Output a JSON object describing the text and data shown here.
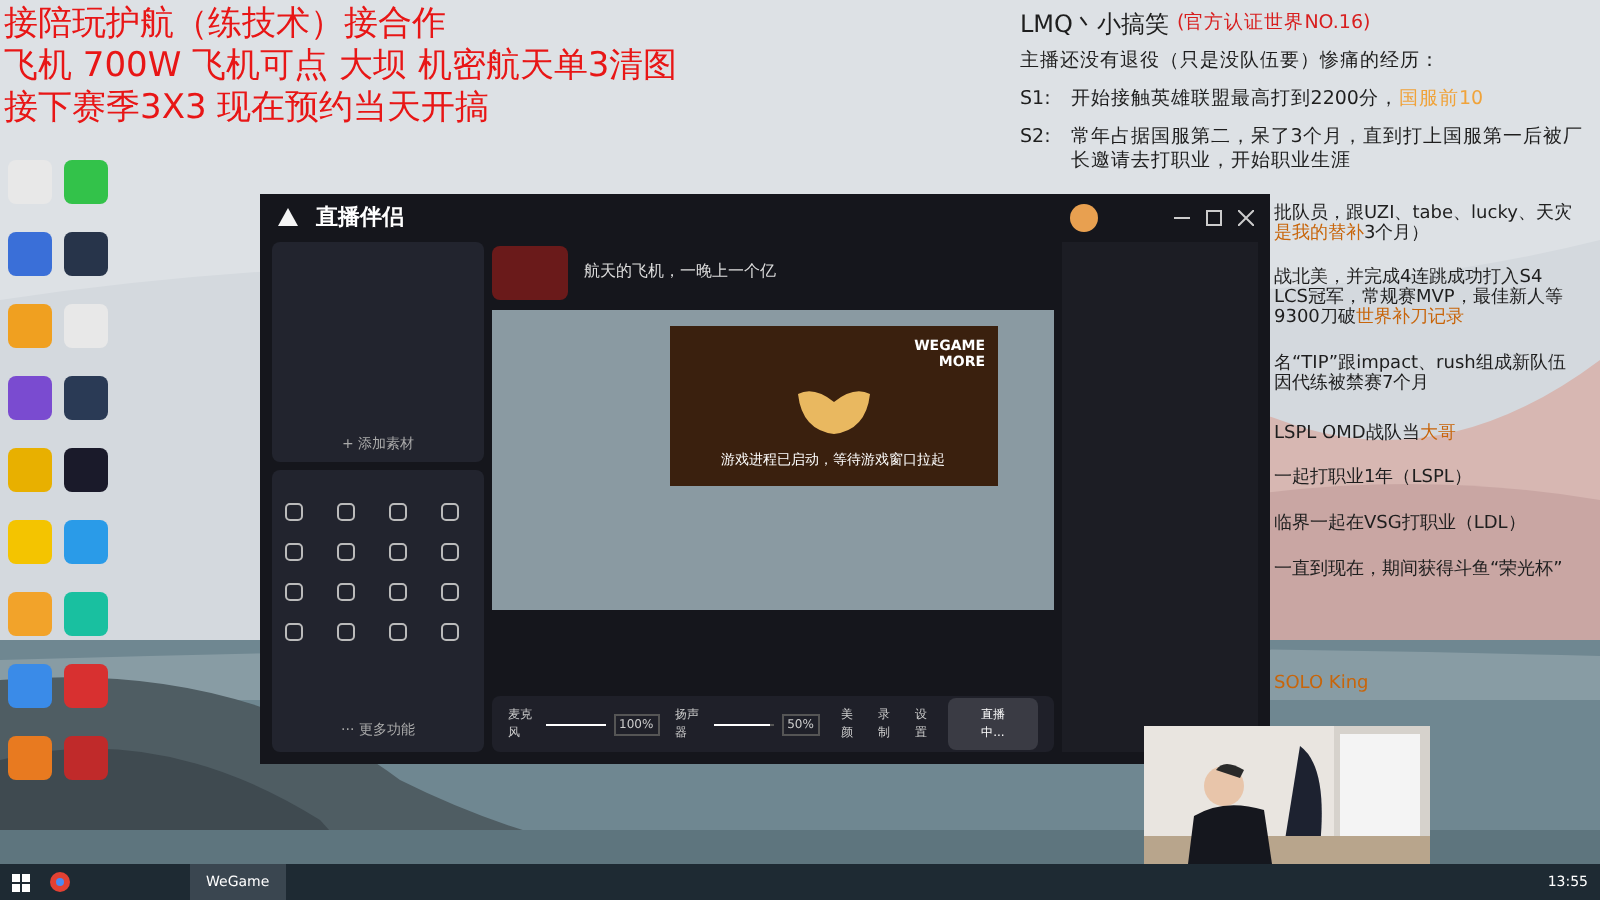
{
  "overlay_text": [
    "接陪玩护航（练技术）接合作",
    "飞机 700W  飞机可点 大坝 机密航天单3清图",
    "接下赛季3X3  现在预约当天开搞"
  ],
  "bio": {
    "name": "LMQ丶小搞笑",
    "badge": "(官方认证世界NO.16)",
    "intro": "主播还没有退役（只是没队伍要）惨痛的经历：",
    "entries": [
      {
        "label": "S1:",
        "text": "开始接触英雄联盟最高打到2200分，",
        "highlight": "国服前10"
      },
      {
        "label": "S2:",
        "text": "常年占据国服第二，呆了3个月，直到打上国服第一后被厂长邀请去打职业，开始职业生涯"
      }
    ],
    "fragments": [
      {
        "text": "批队员，跟UZI、tabe、lucky、天灾"
      },
      {
        "highlight": "是我的替补",
        "rest": "3个月）"
      },
      {
        "text": "战北美，并完成4连跳成功打入S4"
      },
      {
        "text": "LCS冠军，常规赛MVP，最佳新人等"
      },
      {
        "text": "9300刀破",
        "highlight": "世界补刀记录"
      },
      {
        "text": "名“TIP”跟impact、rush组成新队伍"
      },
      {
        "text": "因代练被禁赛7个月"
      },
      {
        "text": "LSPL OMD战队当",
        "highlight": "大哥"
      },
      {
        "text": "一起打职业1年（LSPL）"
      },
      {
        "text": "临界一起在VSG打职业（LDL）"
      },
      {
        "text": "一直到现在，期间获得斗鱼“荣光杯”"
      },
      {
        "highlight": "SOLO King"
      }
    ]
  },
  "app": {
    "title": "直播伴侣",
    "stream_title": "航天的飞机，一晚上一个亿",
    "add_source": "+ 添加素材",
    "preview": {
      "logo_top": "WEGAME",
      "logo_bottom": "MORE",
      "message": "游戏进程已启动，等待游戏窗口拉起"
    },
    "audio": [
      {
        "label": "麦克风",
        "level": 1,
        "reading": "100%"
      },
      {
        "label": "扬声器",
        "level": 0.95,
        "reading": "50%"
      }
    ],
    "tools": [
      "美颜",
      "录制",
      "设置"
    ],
    "live_button": "直播中...",
    "more": "··· 更多功能"
  },
  "taskbar": {
    "apps": [
      {
        "label": "WeGame",
        "selected": true
      }
    ],
    "time": "13:55"
  }
}
